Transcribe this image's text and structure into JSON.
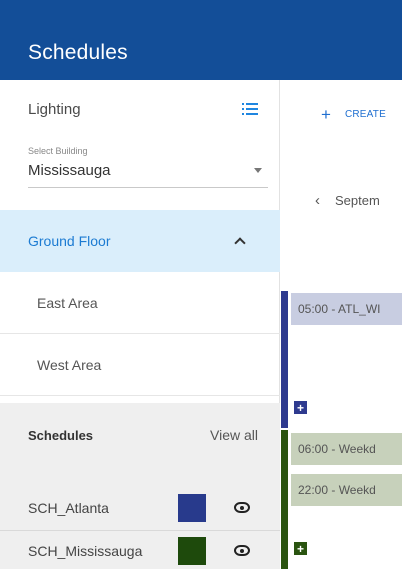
{
  "header": {
    "title": "Schedules"
  },
  "sidebar": {
    "section_label": "Lighting",
    "building_select": {
      "caption": "Select Building",
      "value": "Mississauga"
    },
    "floor": {
      "label": "Ground Floor"
    },
    "areas": [
      {
        "label": "East Area"
      },
      {
        "label": "West Area"
      }
    ],
    "schedules": {
      "title": "Schedules",
      "view_all": "View all",
      "items": [
        {
          "name": "SCH_Atlanta",
          "color": "#283a8c"
        },
        {
          "name": "SCH_Mississauga",
          "color": "#1e4a0c"
        }
      ]
    }
  },
  "main": {
    "create_label": "CREATE",
    "month_label": "Septem",
    "days": [
      {
        "bar_color": "#2e3a8f",
        "event_bg": "#c8cde1",
        "add_color": "#2e3a8f",
        "events": [
          "05:00 - ATL_WI"
        ]
      },
      {
        "bar_color": "#2a5410",
        "event_bg": "#c7d1bb",
        "add_color": "#2a5410",
        "events": [
          "06:00 - Weekd",
          "22:00 - Weekd"
        ]
      }
    ]
  },
  "colors": {
    "header": "#134e98",
    "accent": "#1f86e0",
    "selected_bg": "#daeefb"
  },
  "icons": [
    "list-icon",
    "chevron-down-icon",
    "chevron-up-icon",
    "eye-icon",
    "plus-icon",
    "chevron-left-icon",
    "add-square-icon"
  ]
}
